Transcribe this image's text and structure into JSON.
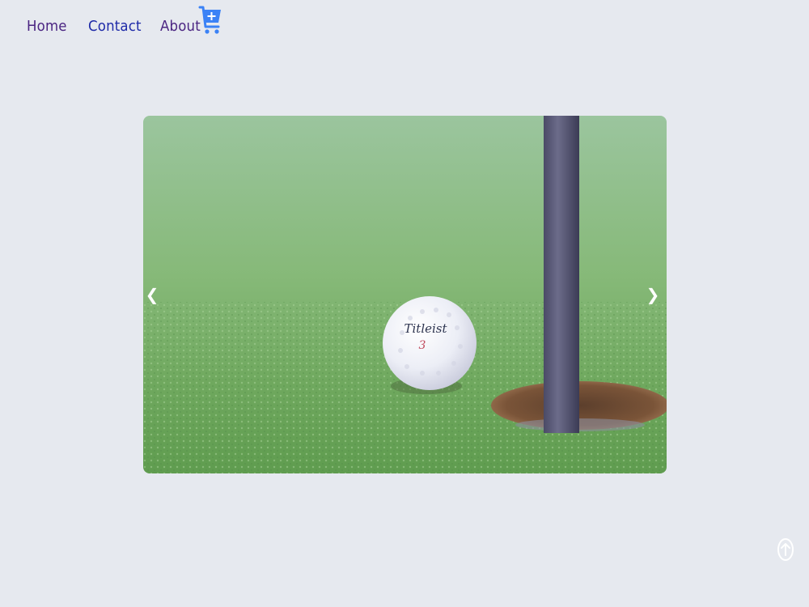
{
  "nav": {
    "home": "Home",
    "contact": "Contact",
    "about": "About",
    "cart_icon": "cart-plus-icon"
  },
  "carousel": {
    "prev_label": "❮",
    "next_label": "❯",
    "slide_subject": "golf ball next to hole with flagstick",
    "ball_brand": "Titleist",
    "ball_number": "3"
  },
  "scroll_top_icon": "arrow-up-circle-icon",
  "colors": {
    "background": "#e6e9ef",
    "link_home": "#4b2582",
    "link_contact": "#1e2aa8",
    "link_about": "#4b2582",
    "cart": "#3b82f6"
  }
}
